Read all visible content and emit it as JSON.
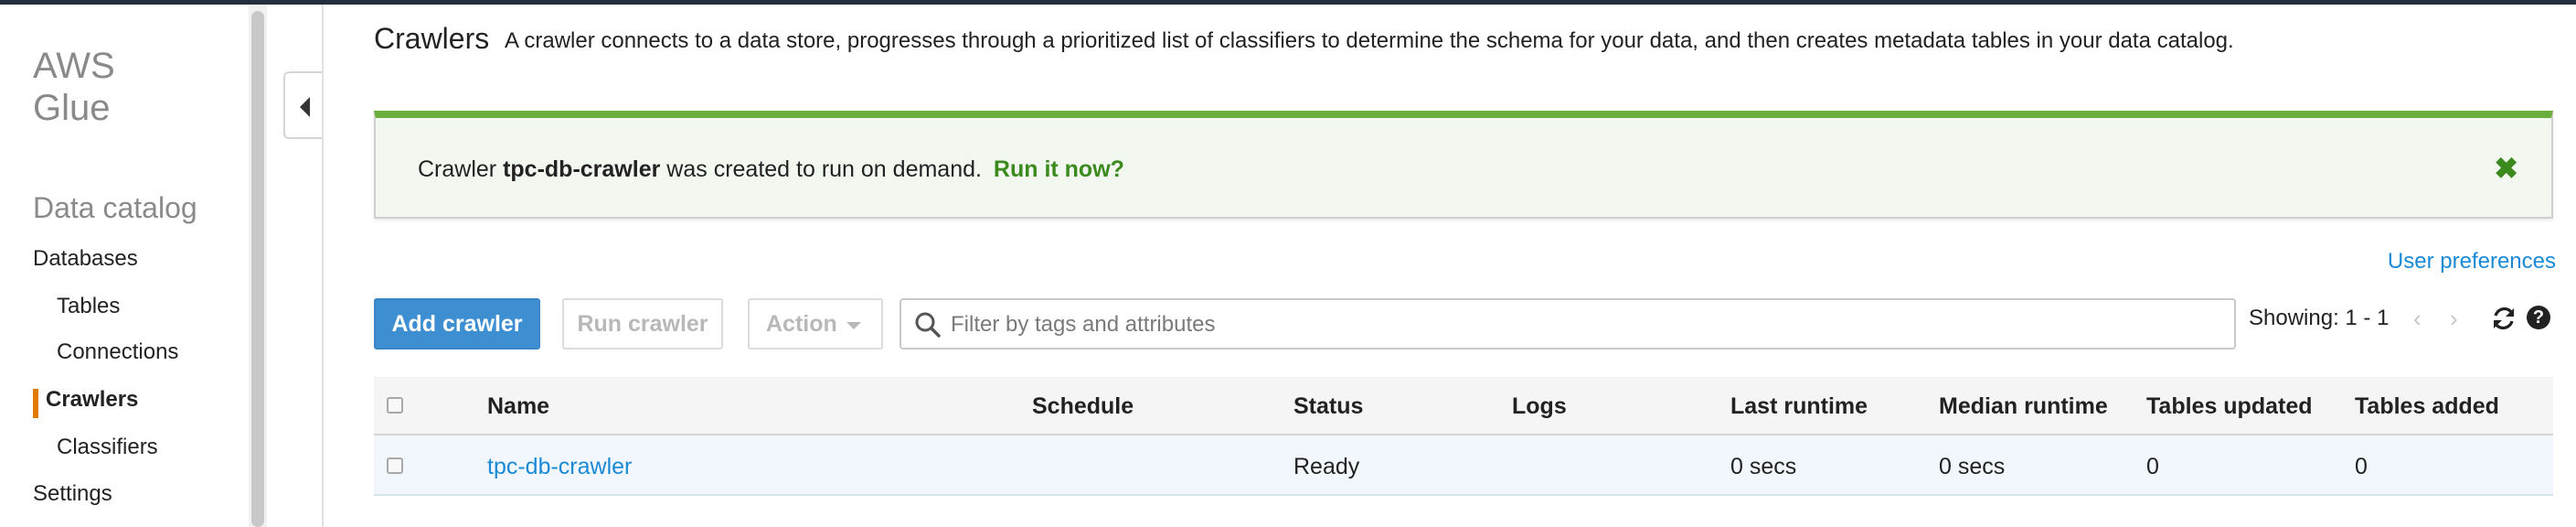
{
  "sidebar": {
    "brand_line1": "AWS",
    "brand_line2": "Glue",
    "section_title": "Data catalog",
    "items": [
      {
        "label": "Databases"
      },
      {
        "label": "Tables"
      },
      {
        "label": "Connections"
      },
      {
        "label": "Crawlers"
      },
      {
        "label": "Classifiers"
      },
      {
        "label": "Settings"
      }
    ],
    "active_item": "Crawlers",
    "accent_color": "#e07b00"
  },
  "header": {
    "title": "Crawlers",
    "description": "A crawler connects to a data store, progresses through a prioritized list of classifiers to determine the schema for your data, and then creates metadata tables in your data catalog."
  },
  "banner": {
    "prefix": "Crawler",
    "crawler_name": "tpc-db-crawler",
    "message": "was created to run on demand.",
    "link_text": "Run it now?",
    "close_icon": "close-x-icon",
    "color": "#6aaf3d"
  },
  "toolbar": {
    "user_preferences": "User preferences",
    "add_crawler": "Add crawler",
    "run_crawler": "Run crawler",
    "action": "Action",
    "filter_placeholder": "Filter by tags and attributes",
    "showing": "Showing: 1 - 1",
    "prev_icon": "chevron-left-icon",
    "next_icon": "chevron-right-icon",
    "refresh_icon": "refresh-icon",
    "help_icon": "help-icon",
    "primary_color": "#3d8fd1"
  },
  "table": {
    "columns": [
      "Name",
      "Schedule",
      "Status",
      "Logs",
      "Last runtime",
      "Median runtime",
      "Tables updated",
      "Tables added"
    ],
    "rows": [
      {
        "name": "tpc-db-crawler",
        "schedule": "",
        "status": "Ready",
        "logs": "",
        "last_runtime": "0 secs",
        "median_runtime": "0 secs",
        "tables_updated": "0",
        "tables_added": "0"
      }
    ]
  }
}
